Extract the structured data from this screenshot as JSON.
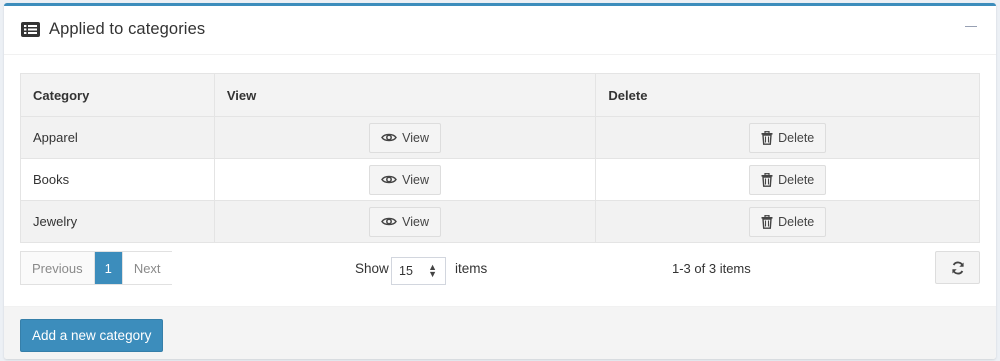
{
  "card": {
    "title": "Applied to categories",
    "icon": "list-alt-icon",
    "collapse_icon": "minus-icon"
  },
  "table": {
    "columns": [
      "Category",
      "View",
      "Delete"
    ],
    "rows": [
      {
        "category": "Apparel",
        "view_label": "View",
        "delete_label": "Delete"
      },
      {
        "category": "Books",
        "view_label": "View",
        "delete_label": "Delete"
      },
      {
        "category": "Jewelry",
        "view_label": "View",
        "delete_label": "Delete"
      }
    ],
    "view_icon": "eye-icon",
    "delete_icon": "trash-icon"
  },
  "pager": {
    "previous": "Previous",
    "current_page": "1",
    "next": "Next",
    "show_label": "Show",
    "page_size": "15",
    "items_label": "items",
    "range_info": "1-3 of 3 items",
    "refresh_icon": "refresh-icon"
  },
  "footer": {
    "add_label": "Add a new category"
  },
  "colors": {
    "accent": "#3c8dbc",
    "header_bg": "#f3f3f3",
    "odd_row_bg": "#f2f2f2",
    "footer_bg": "#f4f4f4"
  }
}
